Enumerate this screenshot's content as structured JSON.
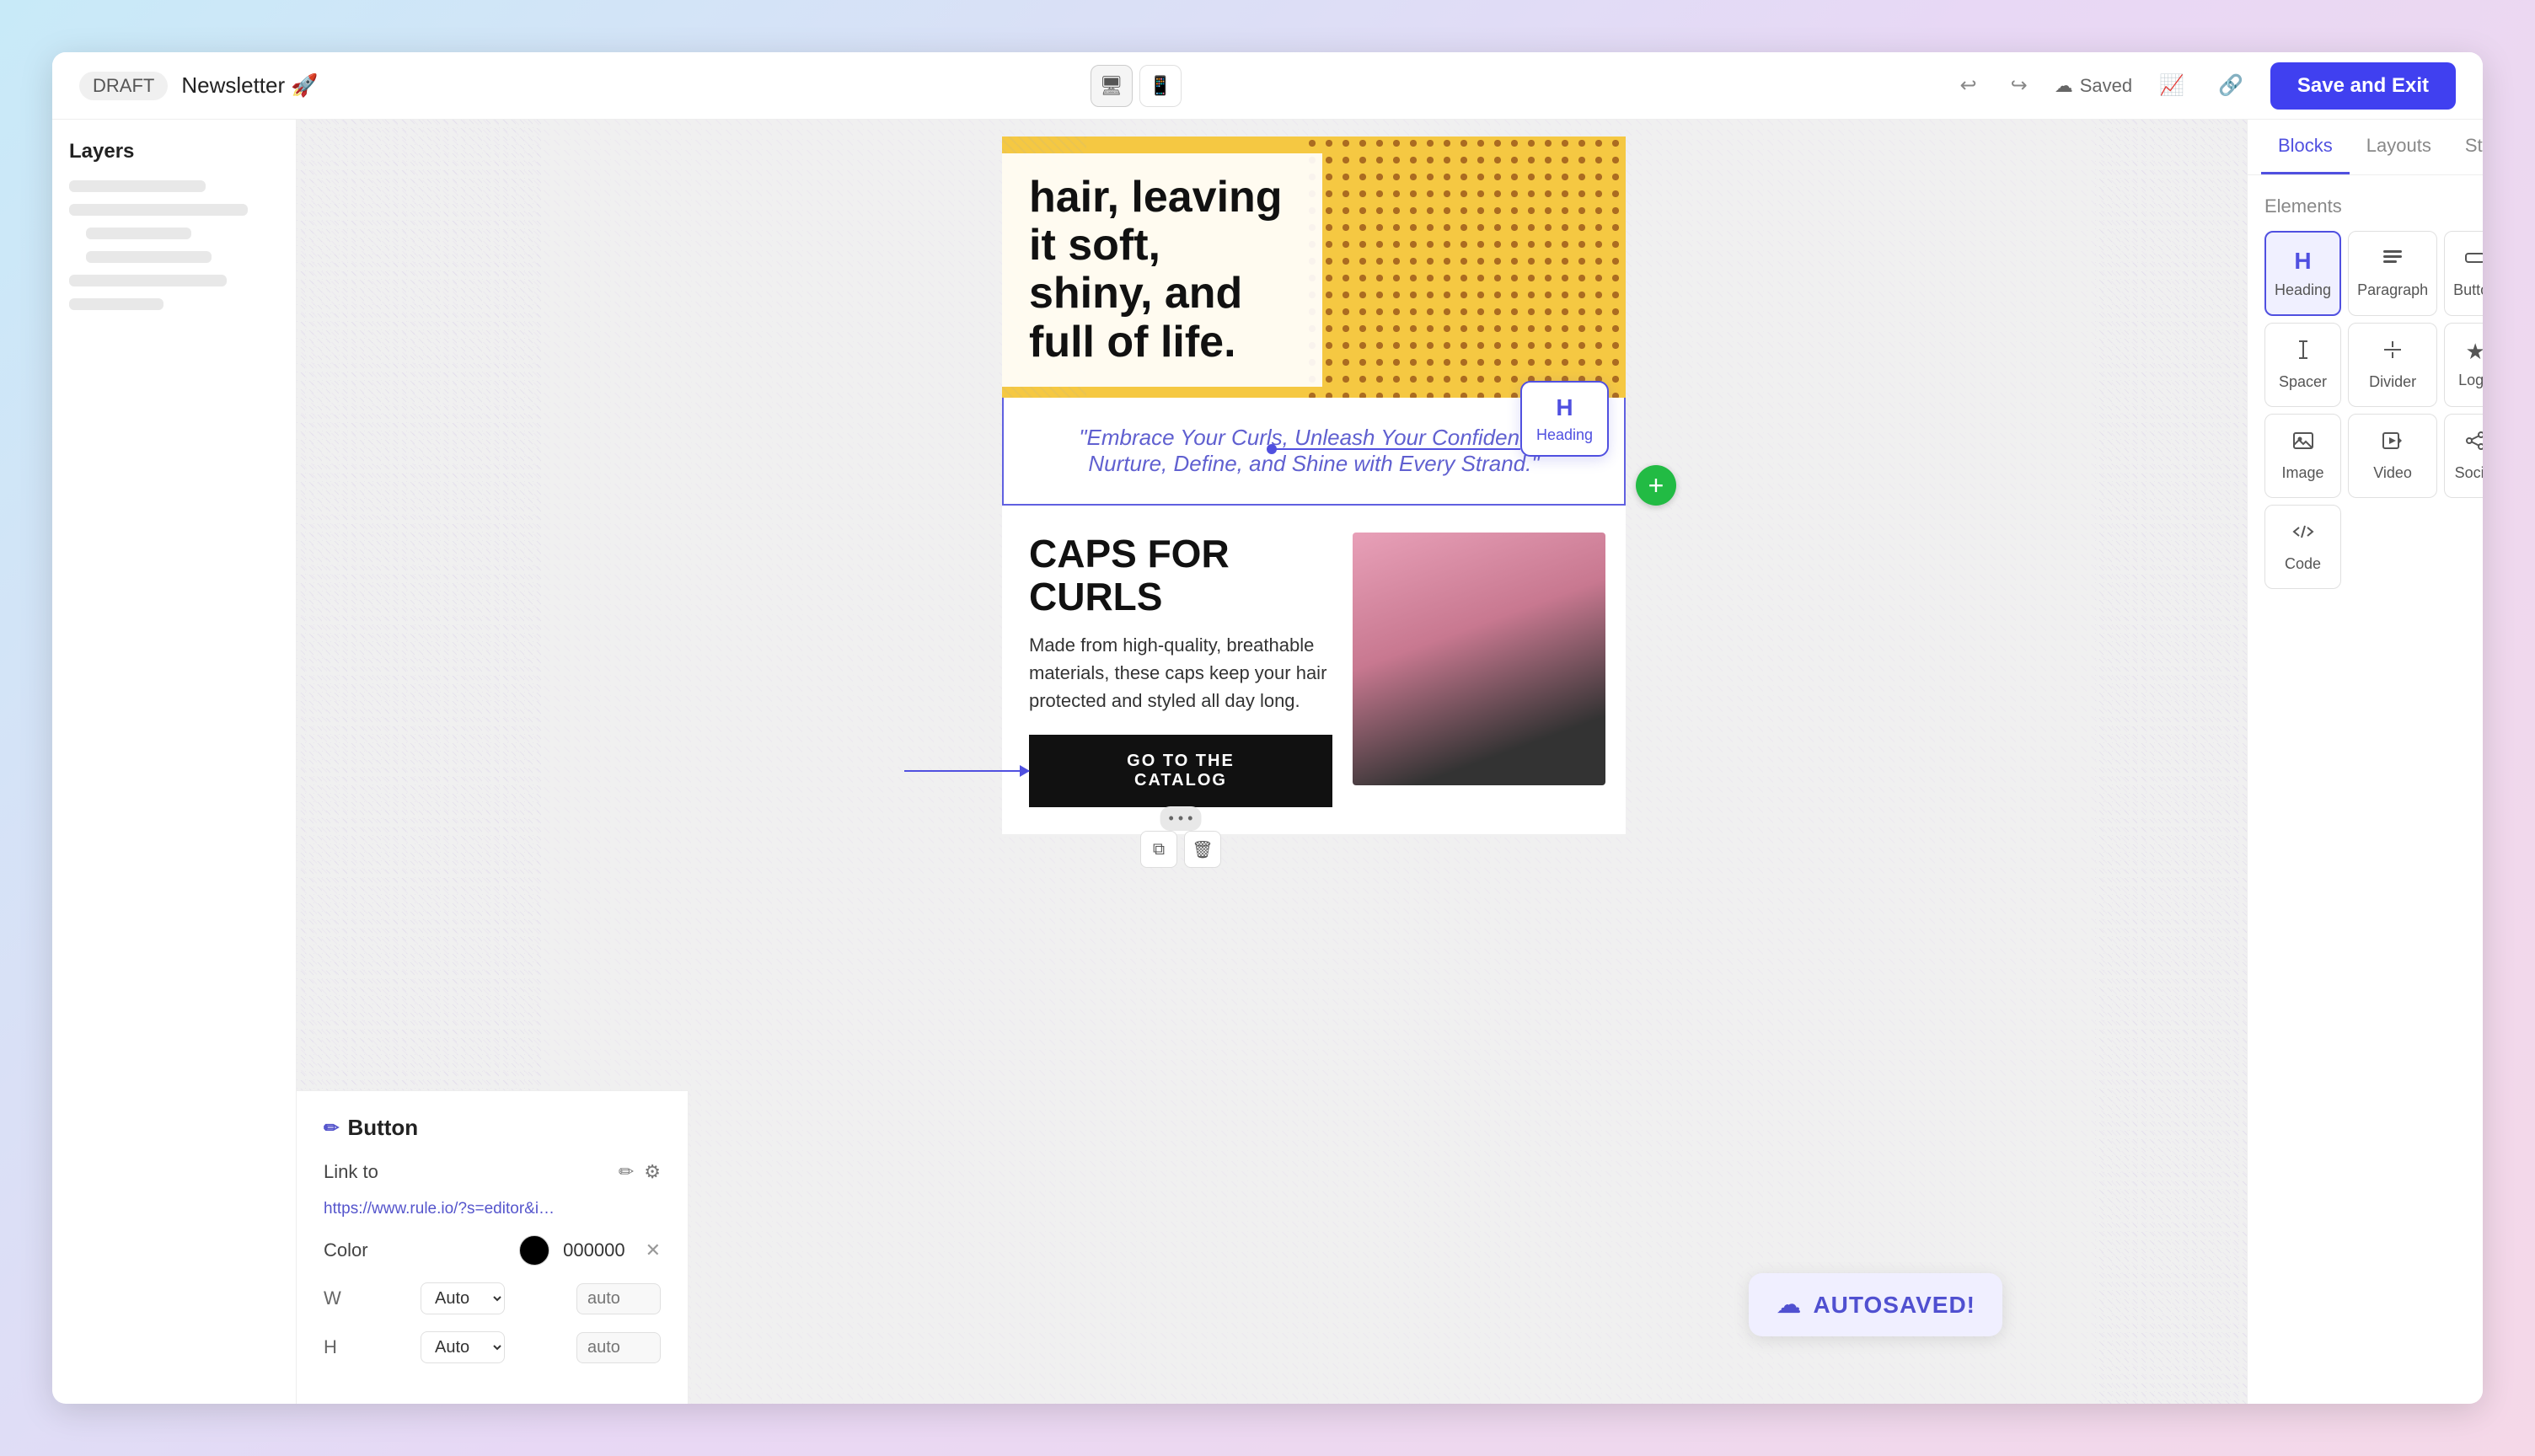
{
  "topbar": {
    "draft_label": "DRAFT",
    "title": "Newsletter 🚀",
    "save_exit_label": "Save and Exit",
    "saved_label": "Saved",
    "device_desktop_title": "Desktop view",
    "device_mobile_title": "Mobile view"
  },
  "left_sidebar": {
    "title": "Layers"
  },
  "canvas": {
    "hero_heading": "hair, leaving it soft, shiny, and full of life.",
    "quote_text": "\"Embrace Your Curls, Unleash Your Confidence. Nurture, Define, and Shine with Every Strand.\"",
    "product_title": "CAPS FOR CURLS",
    "product_desc": "Made from high-quality, breathable materials, these caps keep your hair protected and styled all day long.",
    "cta_label": "GO TO THE CATALOG",
    "heading_drag_h": "H",
    "heading_drag_label": "Heading"
  },
  "bottom_panel": {
    "title": "Button",
    "link_label": "Link to",
    "link_value": "https://www.rule.io/?s=editor&id=321...",
    "color_label": "Color",
    "color_hex": "000000",
    "w_label": "W",
    "h_label": "H",
    "w_value": "Auto",
    "h_value": "Auto",
    "w_placeholder": "auto",
    "h_placeholder": "auto"
  },
  "right_sidebar": {
    "tabs": [
      {
        "label": "Blocks",
        "active": true
      },
      {
        "label": "Layouts",
        "active": false
      },
      {
        "label": "Styles",
        "active": false
      }
    ],
    "elements_title": "Elements",
    "elements": [
      {
        "name": "Heading",
        "icon": "H"
      },
      {
        "name": "Paragraph",
        "icon": "¶"
      },
      {
        "name": "Button",
        "icon": "▭"
      },
      {
        "name": "Spacer",
        "icon": "↕"
      },
      {
        "name": "Divider",
        "icon": "—"
      },
      {
        "name": "Logo",
        "icon": "★"
      },
      {
        "name": "Image",
        "icon": "🖼"
      },
      {
        "name": "Video",
        "icon": "▶"
      },
      {
        "name": "Social",
        "icon": "◎"
      },
      {
        "name": "Code",
        "icon": "<>"
      }
    ]
  },
  "autosaved": {
    "label": "AUTOSAVED!"
  }
}
